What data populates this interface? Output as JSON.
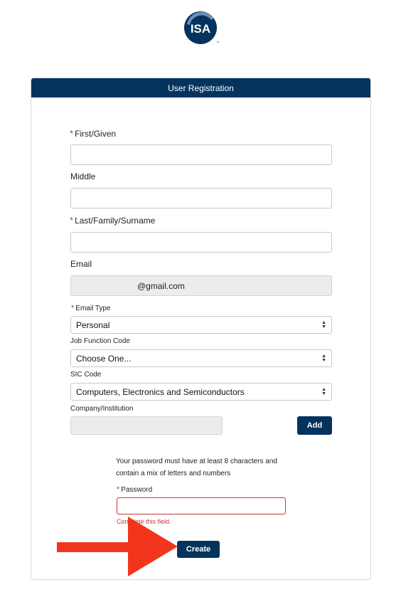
{
  "form": {
    "header": "User Registration",
    "first": {
      "label": "First/Given",
      "value": ""
    },
    "middle": {
      "label": "Middle",
      "value": ""
    },
    "last": {
      "label": "Last/Family/Surname",
      "value": ""
    },
    "email": {
      "label": "Email",
      "value": "@gmail.com"
    },
    "email_type": {
      "label": "Email Type",
      "value": "Personal"
    },
    "job_function": {
      "label": "Job Function Code",
      "value": "Choose One..."
    },
    "sic": {
      "label": "SIC Code",
      "value": "Computers, Electronics and Semiconductors"
    },
    "company": {
      "label": "Company/Institution",
      "value": ""
    },
    "add_button": "Add",
    "password_hint_line1": "Your password must have at least 8 characters and",
    "password_hint_line2": "contain a mix of letters and numbers",
    "password": {
      "label": "Password",
      "value": "",
      "error": "Complete this field."
    },
    "create_button": "Create",
    "required_marker": "*"
  },
  "colors": {
    "brand": "#04345e",
    "error": "#c23934",
    "arrow": "#f2361d"
  },
  "icons": {
    "logo": "isa-logo",
    "select_arrows": "up-down-arrows-icon",
    "annotation": "red-arrow-annotation"
  }
}
